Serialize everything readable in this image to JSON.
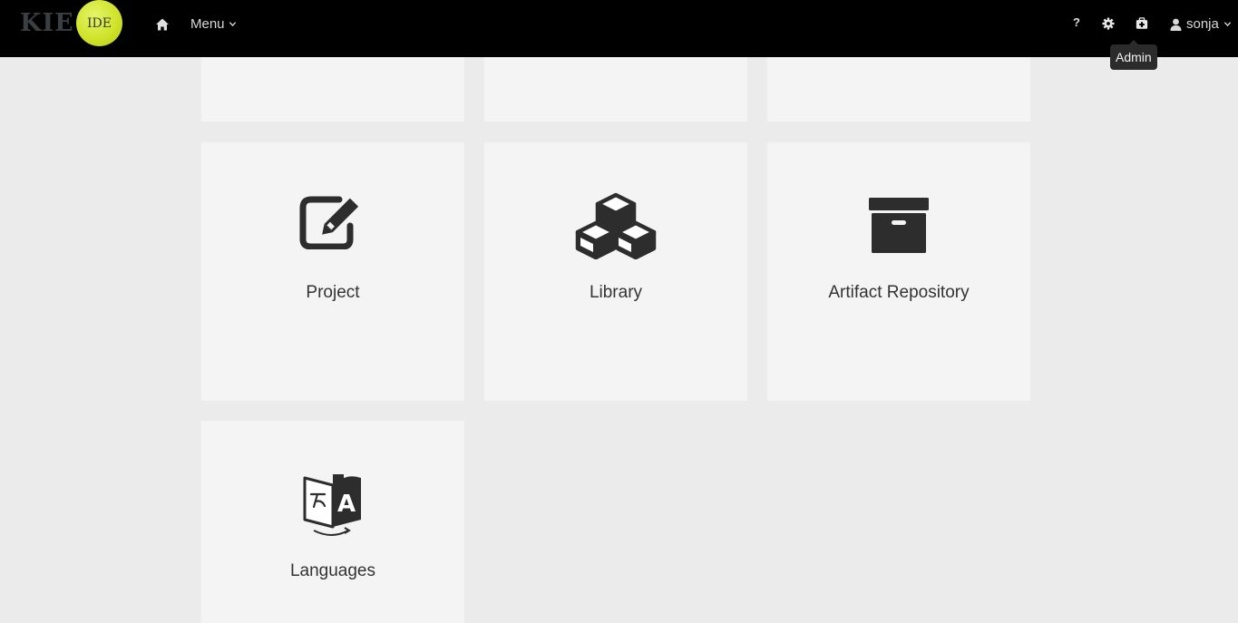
{
  "navbar": {
    "brand_kie": "KIE",
    "brand_ide": "IDE",
    "menu_label": "Menu",
    "help_label": "?",
    "user_label": "sonja",
    "tooltip": "Admin"
  },
  "tiles": [
    {
      "label": "Project",
      "icon": "edit-icon"
    },
    {
      "label": "Library",
      "icon": "cubes-icon"
    },
    {
      "label": "Artifact Repository",
      "icon": "archive-icon"
    },
    {
      "label": "Languages",
      "icon": "language-icon"
    }
  ],
  "colors": {
    "navbar": "#000000",
    "background": "#ebebeb",
    "tile": "#f4f4f4",
    "brand_accent": "#cfe32a",
    "icon": "#2d2d2d"
  }
}
